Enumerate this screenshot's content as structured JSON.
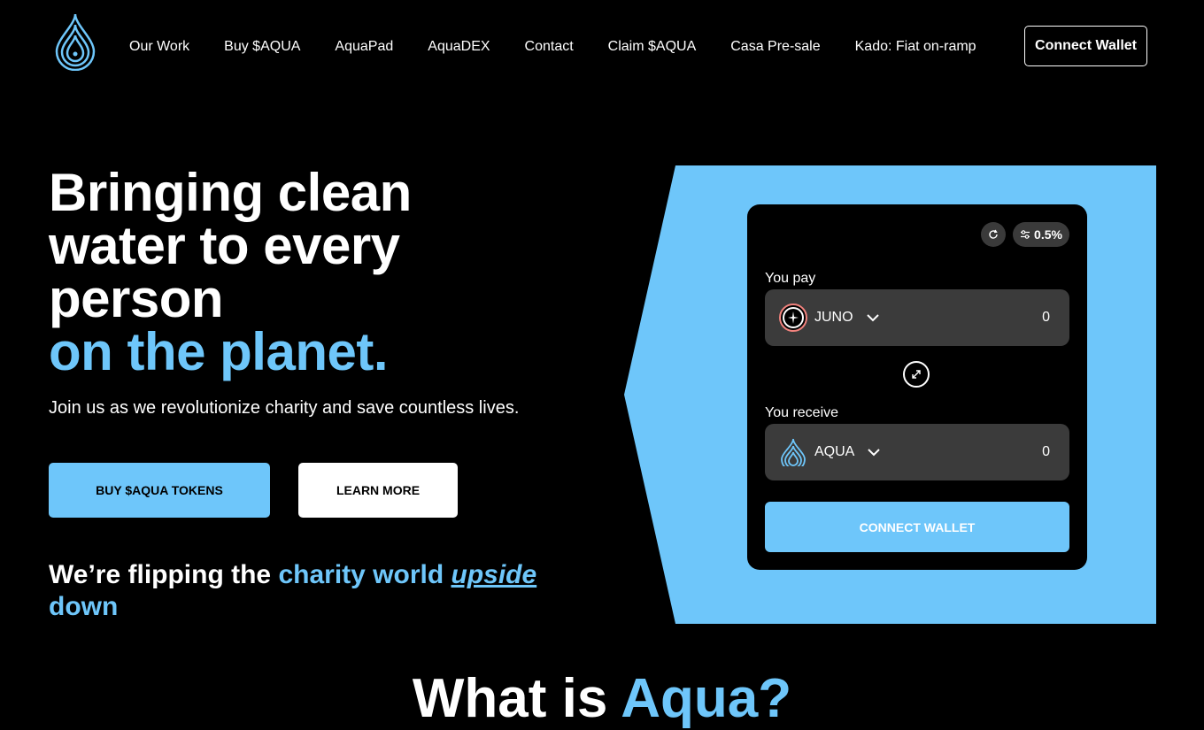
{
  "nav": {
    "logo_icon": "water-drop-logo-icon",
    "links": [
      {
        "label": "Our Work"
      },
      {
        "label": "Buy $AQUA"
      },
      {
        "label": "AquaPad"
      },
      {
        "label": "AquaDEX"
      },
      {
        "label": "Contact"
      },
      {
        "label": "Claim $AQUA"
      },
      {
        "label": "Casa Pre-sale"
      },
      {
        "label": "Kado: Fiat on-ramp"
      }
    ],
    "connect_label": "Connect Wallet"
  },
  "hero": {
    "line1": "Bringing clean",
    "line2": "water to every",
    "line3": "person",
    "accent": "on the planet.",
    "subtitle": "Join us as we revolutionize charity and save countless lives.",
    "buy_label": "BUY $AQUA TOKENS",
    "learn_label": "LEARN MORE"
  },
  "flip": {
    "part1": "We’re flipping the ",
    "part2": "charity world ",
    "part3": "upside",
    "part4": " down"
  },
  "what": {
    "part1": "What is ",
    "part2": "Aqua?"
  },
  "swap": {
    "refresh_icon": "refresh-icon",
    "slippage": "0.5%",
    "pay_label": "You pay",
    "pay_token": "JUNO",
    "pay_amount": "0",
    "receive_label": "You receive",
    "receive_token": "AQUA",
    "receive_amount": "0",
    "connect_label": "CONNECT WALLET"
  },
  "colors": {
    "accent": "#6ec6fa",
    "background": "#000000",
    "field": "#3b3b3b"
  }
}
